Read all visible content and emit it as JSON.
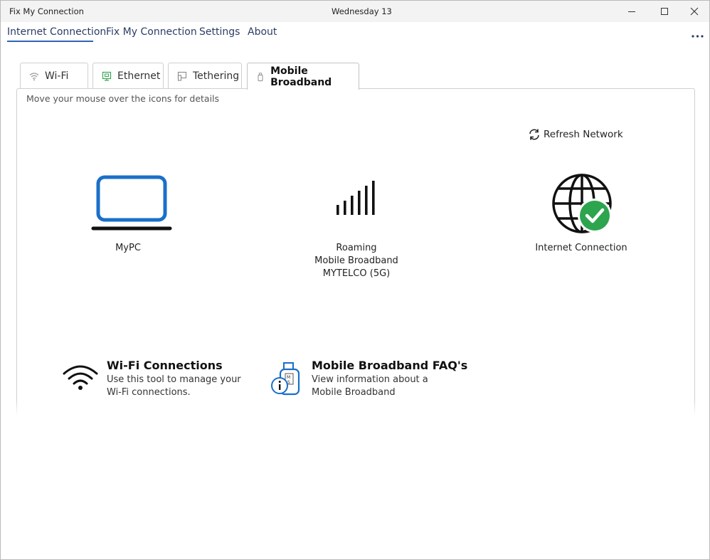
{
  "titlebar": {
    "app_title": "Fix My Connection",
    "date": "Wednesday 13"
  },
  "nav": {
    "items": [
      {
        "label": "Internet Connection",
        "selected": true
      },
      {
        "label": "Fix My Connection",
        "selected": false
      },
      {
        "label": "Settings",
        "selected": false
      },
      {
        "label": "About",
        "selected": false
      }
    ],
    "more_icon": "more-horizontal-icon"
  },
  "tabs": [
    {
      "label": "Wi-Fi",
      "icon": "wifi-icon",
      "active": false
    },
    {
      "label": "Ethernet",
      "icon": "ethernet-icon",
      "active": false
    },
    {
      "label": "Tethering",
      "icon": "tethering-icon",
      "active": false
    },
    {
      "label": "Mobile Broadband",
      "icon": "usb-modem-icon",
      "active": true
    }
  ],
  "panel": {
    "hint": "Move your mouse over the icons for details",
    "refresh_label": "Refresh Network",
    "nodes": {
      "pc": {
        "label": "MyPC",
        "icon": "laptop-icon"
      },
      "network": {
        "line1": "Roaming",
        "line2": "Mobile Broadband",
        "line3": "MYTELCO (5G)",
        "icon": "signal-bars-icon"
      },
      "internet": {
        "label": "Internet Connection",
        "icon": "globe-check-icon"
      }
    },
    "tools": [
      {
        "title": "Wi-Fi Connections",
        "desc_line1": "Use this tool to manage your",
        "desc_line2": "Wi-Fi connections.",
        "icon": "wifi-icon"
      },
      {
        "title": "Mobile Broadband FAQ's",
        "desc_line1": "View information about a",
        "desc_line2": "Mobile Broadband",
        "icon": "usb-modem-info-icon"
      }
    ]
  },
  "colors": {
    "accent": "#2f65b7",
    "laptop": "#1a6fc9",
    "check_green": "#2da44e",
    "nav_text": "#2b3d66"
  }
}
